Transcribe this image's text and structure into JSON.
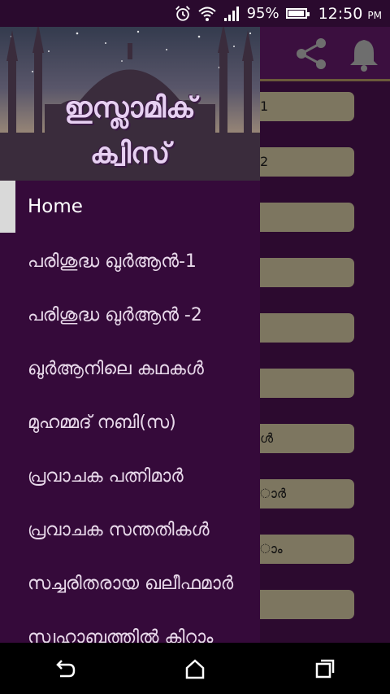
{
  "status_bar": {
    "battery_percent": "95%",
    "time": "12:50",
    "ampm": "PM",
    "icons": [
      "alarm-icon",
      "wifi-icon",
      "signal-icon",
      "battery-icon"
    ]
  },
  "app": {
    "toolbar_icons": [
      "share-icon",
      "bell-icon"
    ],
    "cards": [
      {
        "label": "1"
      },
      {
        "label": "2"
      },
      {
        "label": ""
      },
      {
        "label": ""
      },
      {
        "label": ""
      },
      {
        "label": ""
      },
      {
        "label": "ൾ"
      },
      {
        "label": "ാർ"
      },
      {
        "label": "ാം"
      },
      {
        "label": ""
      }
    ]
  },
  "drawer": {
    "header": {
      "title_line1": "ഇസ്ലാമിക്",
      "title_line2": "ക്വിസ്"
    },
    "items": [
      {
        "label": "Home",
        "active": true
      },
      {
        "label": "പരിശുദ്ധ ഖുർആൻ-1"
      },
      {
        "label": "പരിശുദ്ധ ഖുർആൻ -2"
      },
      {
        "label": "ഖുർആനിലെ കഥകൾ"
      },
      {
        "label": "മുഹമ്മദ് നബി(സ)"
      },
      {
        "label": "പ്രവാചക പത്നിമാർ"
      },
      {
        "label": "പ്രവാചക സന്തതികൾ"
      },
      {
        "label": "സച്ചരിതരായ ഖലീഫമാർ"
      },
      {
        "label": "സ്വഹാബത്തിൽ കിറാം"
      }
    ]
  },
  "navbar": {
    "buttons": [
      "back-icon",
      "home-icon",
      "recents-icon"
    ]
  },
  "colors": {
    "drawer_bg": "#350a3a",
    "app_bg": "#2c0a2f",
    "card_bg": "#7d7660"
  }
}
